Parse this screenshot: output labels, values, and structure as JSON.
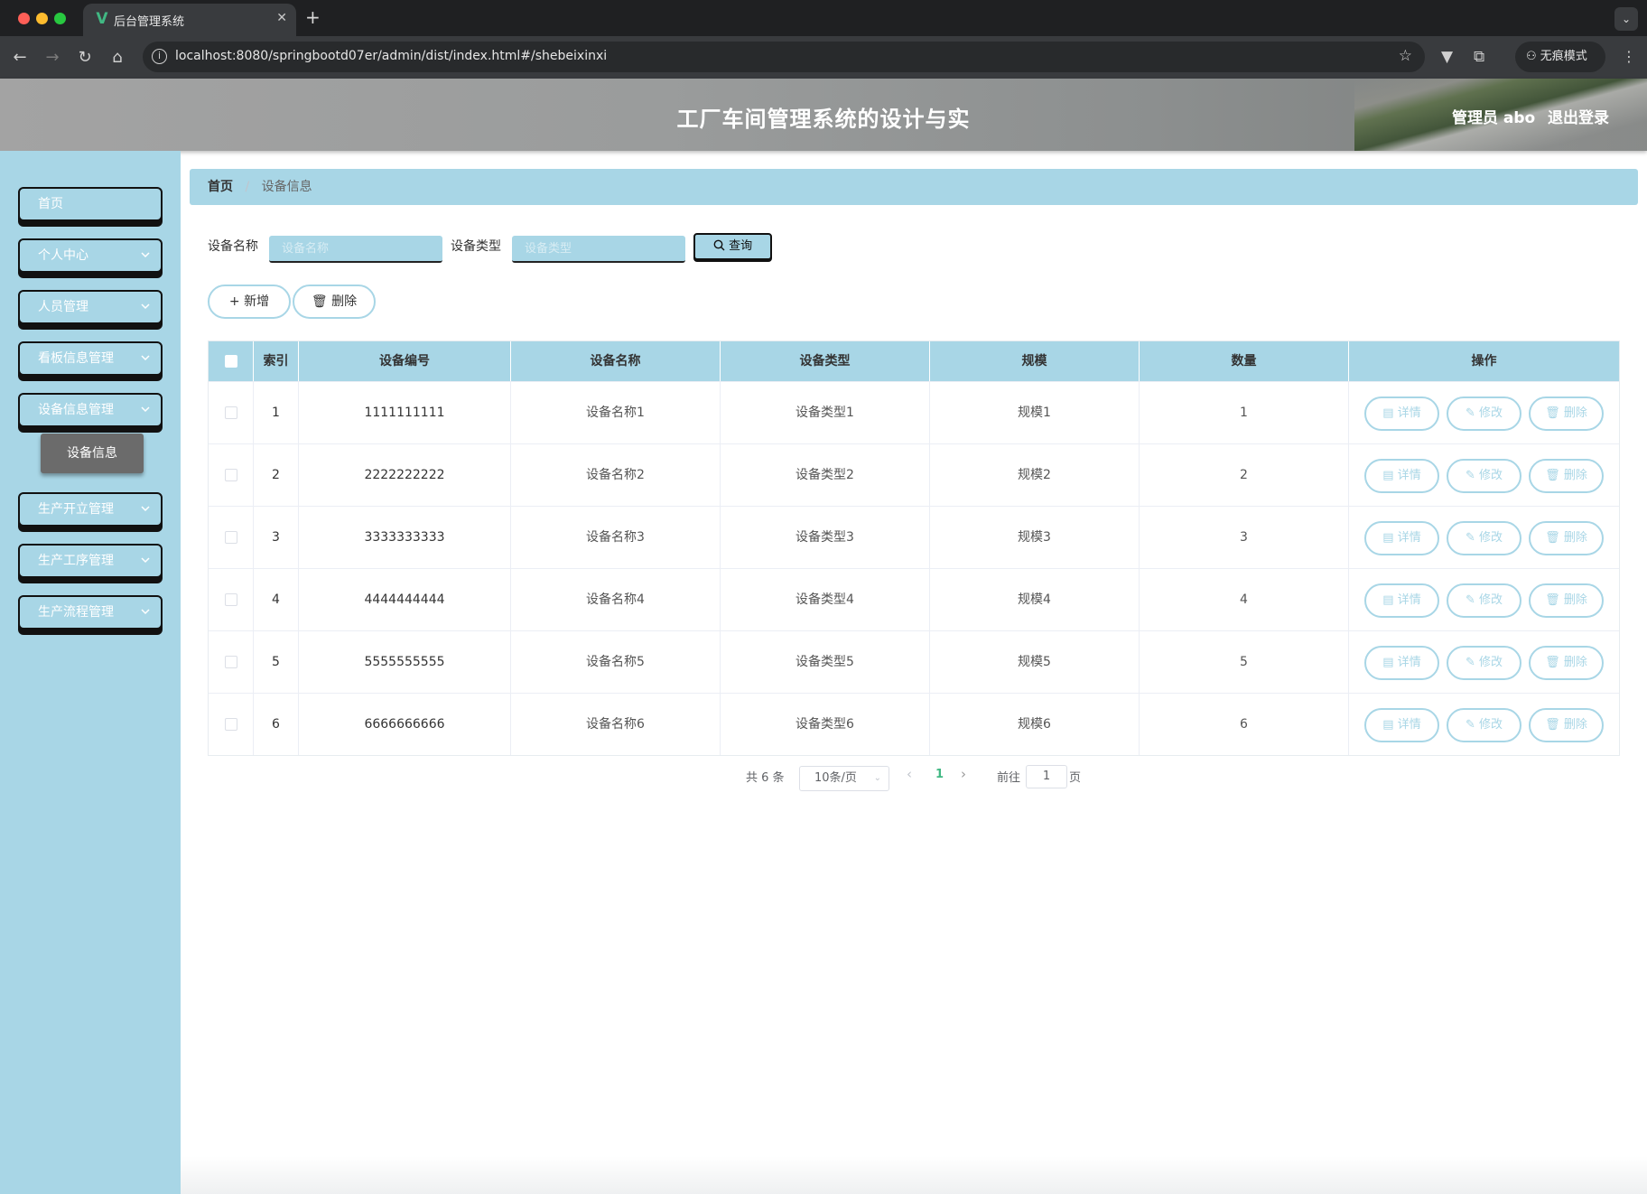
{
  "browser": {
    "tab_title": "后台管理系统",
    "tab_icon": "vue-logo-icon",
    "url": "localhost:8080/springbootd07er/admin/dist/index.html#/shebeixinxi",
    "incognito_label": "无痕模式",
    "traffic_colors": [
      "#ff5f57",
      "#febc2e",
      "#28c840"
    ]
  },
  "header": {
    "title": "工厂车间管理系统的设计与实",
    "user": "管理员 abo",
    "logout": "退出登录"
  },
  "sidebar": {
    "items": [
      {
        "label": "首页",
        "expandable": false
      },
      {
        "label": "个人中心",
        "expandable": true
      },
      {
        "label": "人员管理",
        "expandable": true
      },
      {
        "label": "看板信息管理",
        "expandable": true
      },
      {
        "label": "设备信息管理",
        "expandable": true
      },
      {
        "label": "生产开立管理",
        "expandable": true
      },
      {
        "label": "生产工序管理",
        "expandable": true
      },
      {
        "label": "生产流程管理",
        "expandable": true
      }
    ],
    "active_sub": "设备信息"
  },
  "breadcrumb": {
    "home": "首页",
    "separator": "/",
    "current": "设备信息"
  },
  "search": {
    "name_label": "设备名称",
    "name_placeholder": "设备名称",
    "type_label": "设备类型",
    "type_placeholder": "设备类型",
    "query_button": "查询"
  },
  "actions": {
    "add": "新增",
    "delete": "删除"
  },
  "table": {
    "headers": [
      "索引",
      "设备编号",
      "设备名称",
      "设备类型",
      "规模",
      "数量",
      "操作"
    ],
    "rows": [
      [
        "1",
        "1111111111",
        "设备名称1",
        "设备类型1",
        "规模1",
        "1"
      ],
      [
        "2",
        "2222222222",
        "设备名称2",
        "设备类型2",
        "规模2",
        "2"
      ],
      [
        "3",
        "3333333333",
        "设备名称3",
        "设备类型3",
        "规模3",
        "3"
      ],
      [
        "4",
        "4444444444",
        "设备名称4",
        "设备类型4",
        "规模4",
        "4"
      ],
      [
        "5",
        "5555555555",
        "设备名称5",
        "设备类型5",
        "规模5",
        "5"
      ],
      [
        "6",
        "6666666666",
        "设备名称6",
        "设备类型6",
        "规模6",
        "6"
      ]
    ],
    "row_ops": [
      "详情",
      "修改",
      "删除"
    ]
  },
  "pagination": {
    "total": "共 6 条",
    "page_size": "10条/页",
    "current_page": "1",
    "goto_label": "前往",
    "goto_value": "1",
    "page_suffix": "页"
  },
  "colors": {
    "accent": "#a8d6e6",
    "header_bg": "#9a9c9c",
    "active_sub": "#6b6b6b",
    "page_active": "#41b883"
  }
}
